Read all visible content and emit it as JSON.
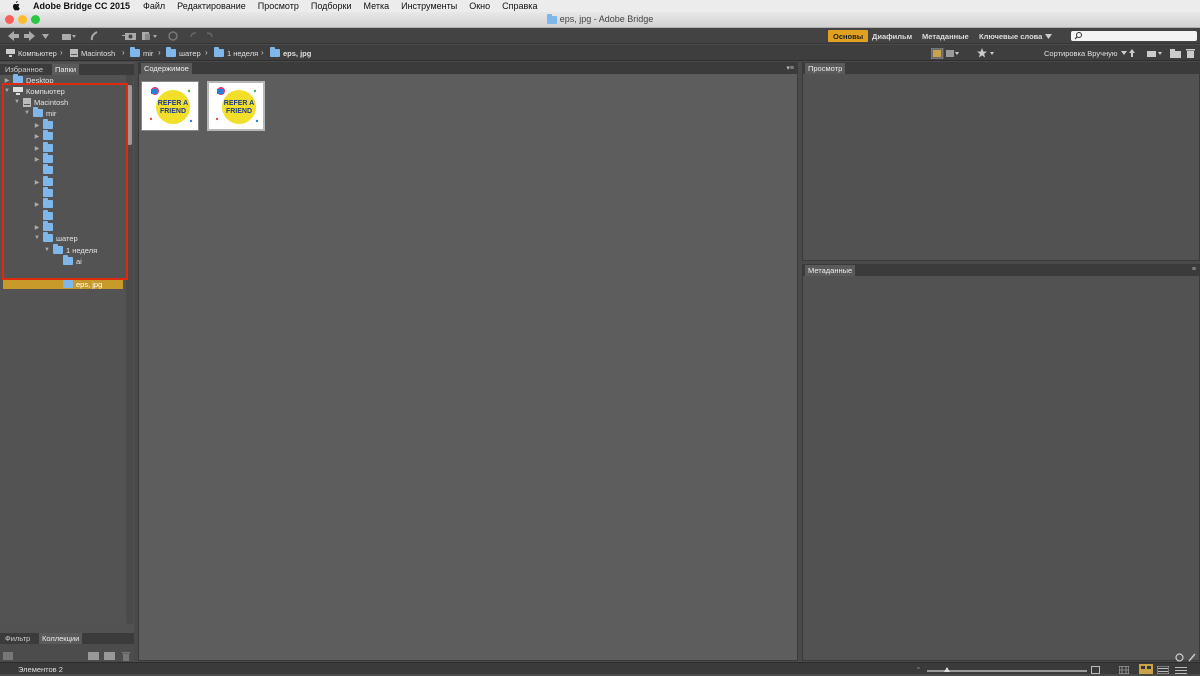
{
  "menubar": {
    "app_name": "Adobe Bridge CC 2015",
    "items": [
      "Файл",
      "Редактирование",
      "Просмотр",
      "Подборки",
      "Метка",
      "Инструменты",
      "Окно",
      "Справка"
    ]
  },
  "window": {
    "title": "eps, jpg - Adobe Bridge"
  },
  "workspaces": {
    "basic": "Основы",
    "filmstrip": "Диафильм",
    "metadata": "Метаданные",
    "keywords": "Ключевые слова"
  },
  "sort": {
    "label": "Сортировка Вручную"
  },
  "search": {
    "placeholder": ""
  },
  "breadcrumb": [
    "Компьютер",
    "Macintosh",
    "mir",
    "шатер",
    "1 неделя",
    "eps, jpg"
  ],
  "left_tabs": {
    "favorites": "Избранное",
    "folders": "Папки"
  },
  "tree": {
    "desktop": "Desktop",
    "computer": "Компьютер",
    "macintosh": "Macintosh",
    "mir": "mir",
    "shater": "шатер",
    "week": "1 неделя",
    "ai": "ai",
    "eps": "eps, jpg"
  },
  "bottom_tabs": {
    "filter": "Фильтр",
    "collections": "Коллекции"
  },
  "content": {
    "tab": "Содержимое",
    "thumb_text_1": "REFER A",
    "thumb_text_2": "FRIEND"
  },
  "preview": {
    "tab": "Просмотр"
  },
  "metadata": {
    "tab": "Метаданные"
  },
  "status": {
    "count": "Элементов 2"
  },
  "colors": {
    "accent": "#e0a020",
    "selection": "#c89a2a",
    "highlight_border": "#e02a10",
    "folder": "#7fb7ea"
  }
}
